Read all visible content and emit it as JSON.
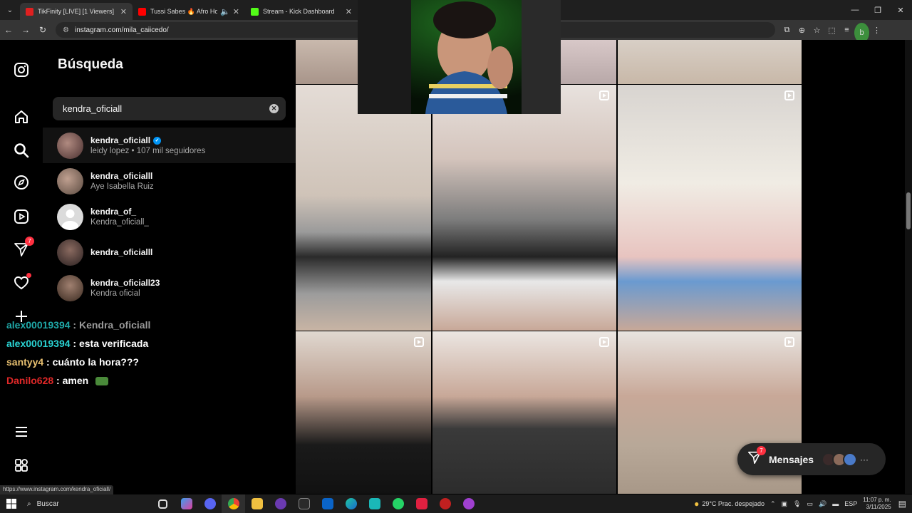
{
  "browser": {
    "tabs": [
      {
        "title": "TikFinity [LIVE] [1 Viewers]",
        "favicon_color": "#e02020",
        "active": true
      },
      {
        "title": "Tussi Sabes 🔥 Afro House",
        "favicon_color": "#ff0000",
        "active": false
      },
      {
        "title": "Stream - Kick Dashboard",
        "favicon_color": "#53fc18",
        "active": false
      }
    ],
    "url": "instagram.com/mila_caiicedo/",
    "profile_initial": "b"
  },
  "search": {
    "title": "Búsqueda",
    "query": "kendra_oficiall",
    "results": [
      {
        "username": "kendra_oficiall",
        "verified": true,
        "subtitle": "leidy lopez • 107 mil seguidores",
        "avatar_color": "#6a4a48"
      },
      {
        "username": "kendra_oficialll",
        "verified": false,
        "subtitle": "Aye Isabella Ruiz",
        "avatar_color": "#7a6a60"
      },
      {
        "username": "kendra_of_",
        "verified": false,
        "subtitle": "Kendra_oficiall_",
        "avatar_color": "#d8d8d8"
      },
      {
        "username": "kendra_oficialll",
        "verified": false,
        "subtitle": "",
        "avatar_color": "#4a3a38"
      },
      {
        "username": "kendra_oficiall23",
        "verified": false,
        "subtitle": "Kendra oficial",
        "avatar_color": "#5a4438"
      }
    ]
  },
  "nav": {
    "notifications_badge": "7"
  },
  "chat": [
    {
      "user": "alex00019394",
      "user_color": "#1fa8a8",
      "message": " : Kendra_oficiall",
      "msg_color": "#9a9a9a"
    },
    {
      "user": "alex00019394",
      "user_color": "#2ad4d4",
      "message": " : esta verificada",
      "msg_color": "#ffffff"
    },
    {
      "user": "santyy4",
      "user_color": "#e8c070",
      "message": " : cuánto la hora???",
      "msg_color": "#ffffff"
    },
    {
      "user": "Danilo628",
      "user_color": "#e02828",
      "message": " : amen",
      "msg_color": "#ffffff"
    }
  ],
  "messages_pill": {
    "label": "Mensajes",
    "badge": "7"
  },
  "status_url": "https://www.instagram.com/kendra_oficiall/",
  "taskbar": {
    "search_label": "Buscar",
    "weather": "29°C  Prac. despejado",
    "language": "ESP",
    "time": "11:07 p. m.",
    "date": "3/11/2025"
  },
  "colors": {
    "ig_bg": "#000000",
    "panel_input": "#262626",
    "accent_blue": "#0095f6",
    "badge_red": "#ff3040"
  }
}
